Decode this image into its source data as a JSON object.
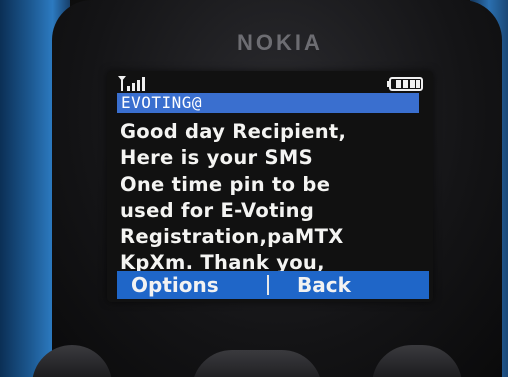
{
  "device": {
    "brand": "NOKIA"
  },
  "status": {
    "signal_icon": "signal-strength-icon",
    "battery_icon": "battery-icon"
  },
  "message": {
    "sender": "EVOTING@",
    "lines": [
      "Good day Recipient,",
      "Here is your SMS",
      "One time pin to be",
      "used for E-Voting",
      "Registration,paMTX",
      "KpXm. Thank you,"
    ]
  },
  "softkeys": {
    "left": "Options",
    "right": "Back"
  },
  "colors": {
    "titlebar": "#3a6fcf",
    "softkey_bar": "#1f66c8",
    "phone_body": "#2c7ac0",
    "screen_bg": "#111111",
    "text": "#f4f4f2"
  }
}
